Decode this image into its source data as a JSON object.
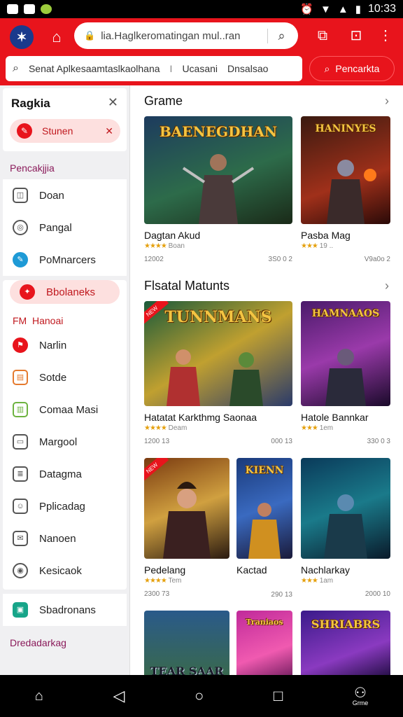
{
  "status": {
    "time": "10:33"
  },
  "browser": {
    "url": "lia.Haglkeromatingan mul..ran",
    "icons": {
      "logo": "sports-logo-icon",
      "home": "home-icon",
      "lock": "lock-icon",
      "search": "search-icon",
      "tab": "tab-icon",
      "bookmark": "bookmark-icon",
      "menu": "more-vert-icon"
    }
  },
  "search": {
    "text": "Senat Aplkesaamtaslkaolhana",
    "divider": "I",
    "option1": "Ucasani",
    "option2": "Dnsalsao",
    "button": "Pencarkta"
  },
  "sidebar": {
    "title": "Ragkia",
    "pill": "Stunen",
    "section1": "Pencakjjia",
    "items1": [
      "Doan",
      "Pangal",
      "PoMnarcers"
    ],
    "active": "Bbolaneks",
    "red_head": "Hanoai",
    "red_head_prefix": "FM",
    "items2": [
      "Narlin",
      "Sotde",
      "Comaa Masi",
      "Margool",
      "Datagma",
      "Pplicadag",
      "Nanoen",
      "Kesicaok",
      "Sbadronans"
    ],
    "footer": "Dredadarkag"
  },
  "sections": [
    {
      "title": "Grame",
      "cards": [
        {
          "art": "BAENEGDHAN",
          "name": "Dagtan Akud",
          "stars": "★★★★",
          "meta": "Boan",
          "s1": "12002",
          "s2": "3S0 0 2"
        },
        {
          "art": "HANINYES",
          "name": "Pasba Mag",
          "stars": "★★★",
          "meta": "19 ..",
          "s1": "",
          "s2": "V9a0o 2"
        }
      ]
    },
    {
      "title": "Flsatal Matunts",
      "cards": [
        {
          "art": "TUNNMANS",
          "name": "Hatatat Karkthmg Saonaa",
          "stars": "★★★★",
          "meta": "Deam",
          "s1": "1200 13",
          "s2": "000 13"
        },
        {
          "art": "HAMNAAOS",
          "name": "Hatole Bannkar",
          "stars": "★★★",
          "meta": "1em",
          "s1": "",
          "s2": "330 0 3"
        },
        {
          "art": "",
          "name": "Pedelang",
          "stars": "★★★★",
          "meta": "Tem",
          "s1": "2300 73",
          "s2": ""
        },
        {
          "art": "KIENN",
          "name": "Kactad",
          "stars": "",
          "meta": "",
          "s1": "",
          "s2": "290 13"
        },
        {
          "art": "",
          "name": "Nachlarkay",
          "stars": "★★★",
          "meta": "1am",
          "s1": "",
          "s2": "2000 10"
        }
      ]
    },
    {
      "cards": [
        {
          "art": "TEAR SAAR"
        },
        {
          "art": "Traniaos"
        },
        {
          "art": "SHRIABRS"
        }
      ]
    }
  ],
  "navbar": {
    "home_label": "",
    "game_label": "Grme"
  },
  "colors": {
    "brand": "#e8141c",
    "pill_bg": "#fde0df",
    "star": "#e5a00d"
  }
}
